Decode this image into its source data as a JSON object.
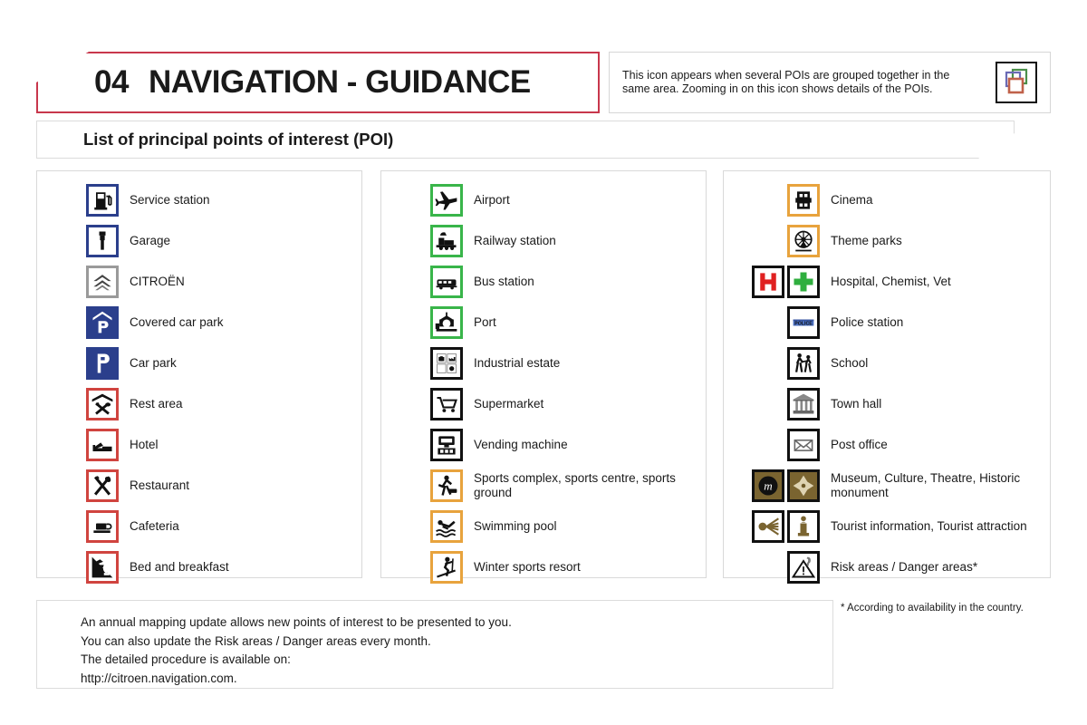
{
  "header": {
    "chapter_number": "04",
    "chapter_title": "NAVIGATION - GUIDANCE",
    "accent_color": "#c8374c",
    "info_text": "This icon appears when several POIs are grouped together in the same area. Zooming in on this icon shows details of the POIs.",
    "info_icon_name": "grouped-pois-icon"
  },
  "subtitle": {
    "text": "List of principal points of interest (POI)"
  },
  "columns": [
    {
      "id": "col0",
      "items": [
        {
          "label": "Service station",
          "icons": [
            "fuel-pump-icon"
          ],
          "border": "b-blue",
          "fill": ""
        },
        {
          "label": "Garage",
          "icons": [
            "wrench-icon"
          ],
          "border": "b-blue",
          "fill": ""
        },
        {
          "label": "CITROËN",
          "icons": [
            "citroen-chevrons-icon"
          ],
          "border": "b-grey",
          "fill": ""
        },
        {
          "label": "Covered car park",
          "icons": [
            "covered-parking-icon"
          ],
          "border": "b-blue",
          "fill": "fill-blue"
        },
        {
          "label": "Car park",
          "icons": [
            "parking-icon"
          ],
          "border": "b-blue",
          "fill": "fill-blue"
        },
        {
          "label": "Rest area",
          "icons": [
            "rest-area-icon"
          ],
          "border": "b-red",
          "fill": ""
        },
        {
          "label": "Hotel",
          "icons": [
            "bed-icon"
          ],
          "border": "b-red",
          "fill": ""
        },
        {
          "label": "Restaurant",
          "icons": [
            "cutlery-icon"
          ],
          "border": "b-red",
          "fill": ""
        },
        {
          "label": "Cafeteria",
          "icons": [
            "coffee-cup-icon"
          ],
          "border": "b-red",
          "fill": ""
        },
        {
          "label": "Bed and breakfast",
          "icons": [
            "bed-and-breakfast-icon"
          ],
          "border": "b-red",
          "fill": ""
        }
      ]
    },
    {
      "id": "col1",
      "items": [
        {
          "label": "Airport",
          "icons": [
            "airplane-icon"
          ],
          "border": "b-green",
          "fill": ""
        },
        {
          "label": "Railway station",
          "icons": [
            "locomotive-icon"
          ],
          "border": "b-green",
          "fill": ""
        },
        {
          "label": "Bus station",
          "icons": [
            "bus-icon"
          ],
          "border": "b-green",
          "fill": ""
        },
        {
          "label": "Port",
          "icons": [
            "ferry-icon"
          ],
          "border": "b-green",
          "fill": ""
        },
        {
          "label": "Industrial estate",
          "icons": [
            "industrial-estate-icon"
          ],
          "border": "b-black",
          "fill": ""
        },
        {
          "label": "Supermarket",
          "icons": [
            "shopping-cart-icon"
          ],
          "border": "b-black",
          "fill": ""
        },
        {
          "label": "Vending machine",
          "icons": [
            "vending-machine-icon"
          ],
          "border": "b-black",
          "fill": ""
        },
        {
          "label": "Sports complex, sports centre, sports ground",
          "icons": [
            "sports-complex-icon"
          ],
          "border": "b-orange",
          "fill": ""
        },
        {
          "label": "Swimming pool",
          "icons": [
            "swimmer-icon"
          ],
          "border": "b-orange",
          "fill": ""
        },
        {
          "label": "Winter sports resort",
          "icons": [
            "skier-icon"
          ],
          "border": "b-orange",
          "fill": ""
        }
      ]
    },
    {
      "id": "col2",
      "items": [
        {
          "label": "Cinema",
          "icons": [
            "film-reel-icon"
          ],
          "border": "b-orange",
          "fill": ""
        },
        {
          "label": "Theme parks",
          "icons": [
            "ferris-wheel-icon"
          ],
          "border": "b-orange",
          "fill": ""
        },
        {
          "label": "Hospital, Chemist, Vet",
          "icons": [
            "hospital-h-icon",
            "green-cross-icon"
          ],
          "border": "b-black",
          "fill": ""
        },
        {
          "label": "Police station",
          "icons": [
            "police-icon"
          ],
          "border": "b-black",
          "fill": ""
        },
        {
          "label": "School",
          "icons": [
            "school-children-icon"
          ],
          "border": "b-black",
          "fill": ""
        },
        {
          "label": "Town hall",
          "icons": [
            "town-hall-icon"
          ],
          "border": "b-black",
          "fill": ""
        },
        {
          "label": "Post office",
          "icons": [
            "envelope-icon"
          ],
          "border": "b-black",
          "fill": ""
        },
        {
          "label": "Museum, Culture, Theatre, Historic monument",
          "icons": [
            "museum-m-icon",
            "historic-monument-icon"
          ],
          "border": "b-black",
          "fill": "fill-brown"
        },
        {
          "label": "Tourist information, Tourist attraction",
          "icons": [
            "tourist-attraction-icon",
            "tourist-info-i-icon"
          ],
          "border": "b-black",
          "fill": ""
        },
        {
          "label": "Risk areas / Danger areas*",
          "icons": [
            "danger-warning-icon"
          ],
          "border": "b-black",
          "fill": ""
        }
      ]
    }
  ],
  "note": {
    "lines": [
      "An annual mapping update allows new points of interest to be presented to you.",
      "You can also update the Risk areas / Danger areas every month.",
      "The detailed procedure is available on:",
      "http://citroen.navigation.com."
    ]
  },
  "footnote": {
    "text": "* According to availability in the country."
  }
}
